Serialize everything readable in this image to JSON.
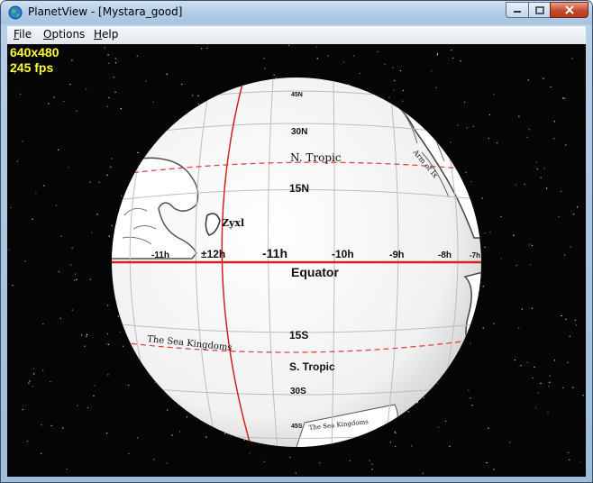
{
  "window": {
    "title": "PlanetView - [Mystara_good]",
    "controls": {
      "minimize": "minimize",
      "maximize": "maximize",
      "close": "close"
    }
  },
  "menu": {
    "items": [
      {
        "label_first": "F",
        "label_rest": "ile"
      },
      {
        "label_first": "O",
        "label_rest": "ptions"
      },
      {
        "label_first": "H",
        "label_rest": "elp"
      }
    ]
  },
  "overlay": {
    "resolution": "640x480",
    "fps": "245 fps"
  },
  "map": {
    "latitude_labels": [
      "45N",
      "30N",
      "15N",
      "15S",
      "30S",
      "45S"
    ],
    "longitude_labels": [
      "-11h",
      "±12h",
      "-11h",
      "-10h",
      "-9h",
      "-8h",
      "-7h"
    ],
    "line_labels": {
      "north_tropic": "N. Tropic",
      "equator": "Equator",
      "south_tropic": "S. Tropic"
    },
    "place_labels": [
      "Zyxl",
      "The Sea Kingdoms",
      "Arm of Ix",
      "The Sea Kingdoms"
    ],
    "colors": {
      "globe": "#f4f4f4",
      "grid": "#b9b9b9",
      "equator": "#d42020",
      "tropic": "#e04545",
      "space": "#050505",
      "overlay_text": "#ffff33"
    }
  }
}
